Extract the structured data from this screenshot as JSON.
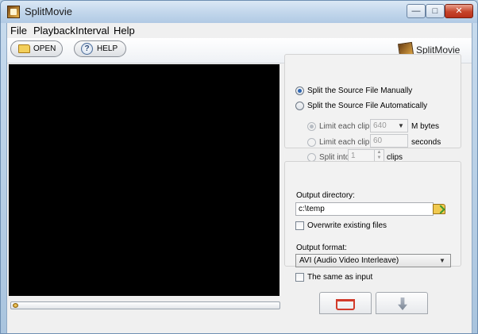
{
  "window": {
    "title": "SplitMovie"
  },
  "menu": {
    "file": "File",
    "playback": "Playback",
    "interval": "Interval",
    "help": "Help"
  },
  "toolbar": {
    "open_label": "OPEN",
    "help_label": "HELP",
    "brand": "SplitMovie"
  },
  "split": {
    "manual_label": "Split the Source File Manually",
    "auto_label": "Split the Source File Automatically",
    "limit_size_label": "Limit each clip to",
    "limit_size_value": "640",
    "limit_size_unit": "M bytes",
    "limit_time_label": "Limit each clip to",
    "limit_time_value": "60",
    "limit_time_unit": "seconds",
    "split_into_label": "Split into",
    "split_into_value": "1",
    "split_into_unit": "clips"
  },
  "output": {
    "directory_label": "Output directory:",
    "directory_value": "c:\\temp",
    "overwrite_label": "Overwrite existing files",
    "format_label": "Output format:",
    "format_value": "AVI (Audio Video Interleave)",
    "same_as_input_label": "The same as input"
  },
  "icons": {
    "app": "film-slate-icon",
    "open": "folder-open-icon",
    "help": "question-circle-icon",
    "browse": "folder-arrow-icon",
    "cart": "cart-icon",
    "cut": "cut-arrow-icon"
  },
  "colors": {
    "accent": "#2e66b3",
    "close_button": "#c6442a",
    "cart_icon": "#d23a2a"
  }
}
